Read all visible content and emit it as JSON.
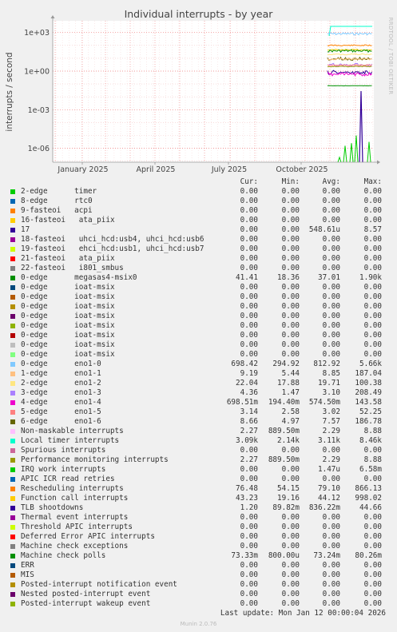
{
  "chart_data": {
    "type": "line",
    "title": "Individual interrupts - by year",
    "ylabel": "interrupts / second",
    "y_scale": "log",
    "yticks": [
      "1e+03",
      "1e+00",
      "1e-03",
      "1e-06"
    ],
    "xticks": [
      "January 2025",
      "April 2025",
      "July 2025",
      "October 2025"
    ],
    "x_range": [
      "2024-12-01",
      "2026-01-12"
    ],
    "grid": true,
    "side_text": "RRDTOOL / TOBI OETIKER",
    "legend_headers": [
      "Cur:",
      "Min:",
      "Avg:",
      "Max:"
    ],
    "legend": [
      {
        "name": "2-edge      timer",
        "color": "#00cc00",
        "cur": "0.00",
        "min": "0.00",
        "avg": "0.00",
        "max": "0.00"
      },
      {
        "name": "8-edge      rtc0",
        "color": "#0066b3",
        "cur": "0.00",
        "min": "0.00",
        "avg": "0.00",
        "max": "0.00"
      },
      {
        "name": "9-fasteoi   acpi",
        "color": "#ff8000",
        "cur": "0.00",
        "min": "0.00",
        "avg": "0.00",
        "max": "0.00"
      },
      {
        "name": "16-fasteoi   ata_piix",
        "color": "#ffcc00",
        "cur": "0.00",
        "min": "0.00",
        "avg": "0.00",
        "max": "0.00"
      },
      {
        "name": "17",
        "color": "#330099",
        "cur": "0.00",
        "min": "0.00",
        "avg": "548.61u",
        "max": "8.57"
      },
      {
        "name": "18-fasteoi   uhci_hcd:usb4, uhci_hcd:usb6",
        "color": "#990099",
        "cur": "0.00",
        "min": "0.00",
        "avg": "0.00",
        "max": "0.00"
      },
      {
        "name": "19-fasteoi   ehci_hcd:usb1, uhci_hcd:usb7",
        "color": "#ccff00",
        "cur": "0.00",
        "min": "0.00",
        "avg": "0.00",
        "max": "0.00"
      },
      {
        "name": "21-fasteoi   ata_piix",
        "color": "#ff0000",
        "cur": "0.00",
        "min": "0.00",
        "avg": "0.00",
        "max": "0.00"
      },
      {
        "name": "22-fasteoi   i801_smbus",
        "color": "#808080",
        "cur": "0.00",
        "min": "0.00",
        "avg": "0.00",
        "max": "0.00"
      },
      {
        "name": "0-edge      megasas4-msix0",
        "color": "#008f00",
        "cur": "41.41",
        "min": "18.36",
        "avg": "37.01",
        "max": "1.90k"
      },
      {
        "name": "0-edge      ioat-msix",
        "color": "#00487d",
        "cur": "0.00",
        "min": "0.00",
        "avg": "0.00",
        "max": "0.00"
      },
      {
        "name": "0-edge      ioat-msix",
        "color": "#b35a00",
        "cur": "0.00",
        "min": "0.00",
        "avg": "0.00",
        "max": "0.00"
      },
      {
        "name": "0-edge      ioat-msix",
        "color": "#b38f00",
        "cur": "0.00",
        "min": "0.00",
        "avg": "0.00",
        "max": "0.00"
      },
      {
        "name": "0-edge      ioat-msix",
        "color": "#6b006b",
        "cur": "0.00",
        "min": "0.00",
        "avg": "0.00",
        "max": "0.00"
      },
      {
        "name": "0-edge      ioat-msix",
        "color": "#8fb300",
        "cur": "0.00",
        "min": "0.00",
        "avg": "0.00",
        "max": "0.00"
      },
      {
        "name": "0-edge      ioat-msix",
        "color": "#b30000",
        "cur": "0.00",
        "min": "0.00",
        "avg": "0.00",
        "max": "0.00"
      },
      {
        "name": "0-edge      ioat-msix",
        "color": "#bebebe",
        "cur": "0.00",
        "min": "0.00",
        "avg": "0.00",
        "max": "0.00"
      },
      {
        "name": "0-edge      ioat-msix",
        "color": "#80ff80",
        "cur": "0.00",
        "min": "0.00",
        "avg": "0.00",
        "max": "0.00"
      },
      {
        "name": "0-edge      eno1-0",
        "color": "#80c9ff",
        "cur": "698.42",
        "min": "294.92",
        "avg": "812.92",
        "max": "5.66k"
      },
      {
        "name": "1-edge      eno1-1",
        "color": "#ffc080",
        "cur": "9.19",
        "min": "5.44",
        "avg": "8.85",
        "max": "187.04"
      },
      {
        "name": "2-edge      eno1-2",
        "color": "#ffe680",
        "cur": "22.04",
        "min": "17.88",
        "avg": "19.71",
        "max": "100.38"
      },
      {
        "name": "3-edge      eno1-3",
        "color": "#aa80ff",
        "cur": "4.36",
        "min": "1.47",
        "avg": "3.10",
        "max": "208.49"
      },
      {
        "name": "4-edge      eno1-4",
        "color": "#ee00cc",
        "cur": "698.51m",
        "min": "194.40m",
        "avg": "574.50m",
        "max": "143.58"
      },
      {
        "name": "5-edge      eno1-5",
        "color": "#ff8080",
        "cur": "3.14",
        "min": "2.58",
        "avg": "3.02",
        "max": "52.25"
      },
      {
        "name": "6-edge      eno1-6",
        "color": "#666600",
        "cur": "8.66",
        "min": "4.97",
        "avg": "7.57",
        "max": "186.78"
      },
      {
        "name": "Non-maskable interrupts",
        "color": "#ffbfff",
        "cur": "2.27",
        "min": "889.50m",
        "avg": "2.29",
        "max": "8.88"
      },
      {
        "name": "Local timer interrupts",
        "color": "#00ffcc",
        "cur": "3.09k",
        "min": "2.14k",
        "avg": "3.11k",
        "max": "8.46k"
      },
      {
        "name": "Spurious interrupts",
        "color": "#cc6699",
        "cur": "0.00",
        "min": "0.00",
        "avg": "0.00",
        "max": "0.00"
      },
      {
        "name": "Performance monitoring interrupts",
        "color": "#999900",
        "cur": "2.27",
        "min": "889.50m",
        "avg": "2.29",
        "max": "8.88"
      },
      {
        "name": "IRQ work interrupts",
        "color": "#00cc00",
        "cur": "0.00",
        "min": "0.00",
        "avg": "1.47u",
        "max": "6.58m"
      },
      {
        "name": "APIC ICR read retries",
        "color": "#0066b3",
        "cur": "0.00",
        "min": "0.00",
        "avg": "0.00",
        "max": "0.00"
      },
      {
        "name": "Rescheduling interrupts",
        "color": "#ff8000",
        "cur": "76.48",
        "min": "54.15",
        "avg": "79.10",
        "max": "866.13"
      },
      {
        "name": "Function call interrupts",
        "color": "#ffcc00",
        "cur": "43.23",
        "min": "19.16",
        "avg": "44.12",
        "max": "998.02"
      },
      {
        "name": "TLB shootdowns",
        "color": "#330099",
        "cur": "1.20",
        "min": "89.82m",
        "avg": "836.22m",
        "max": "44.66"
      },
      {
        "name": "Thermal event interrupts",
        "color": "#990099",
        "cur": "0.00",
        "min": "0.00",
        "avg": "0.00",
        "max": "0.00"
      },
      {
        "name": "Threshold APIC interrupts",
        "color": "#ccff00",
        "cur": "0.00",
        "min": "0.00",
        "avg": "0.00",
        "max": "0.00"
      },
      {
        "name": "Deferred Error APIC interrupts",
        "color": "#ff0000",
        "cur": "0.00",
        "min": "0.00",
        "avg": "0.00",
        "max": "0.00"
      },
      {
        "name": "Machine check exceptions",
        "color": "#808080",
        "cur": "0.00",
        "min": "0.00",
        "avg": "0.00",
        "max": "0.00"
      },
      {
        "name": "Machine check polls",
        "color": "#008f00",
        "cur": "73.33m",
        "min": "800.00u",
        "avg": "73.24m",
        "max": "80.26m"
      },
      {
        "name": "ERR",
        "color": "#00487d",
        "cur": "0.00",
        "min": "0.00",
        "avg": "0.00",
        "max": "0.00"
      },
      {
        "name": "MIS",
        "color": "#b35a00",
        "cur": "0.00",
        "min": "0.00",
        "avg": "0.00",
        "max": "0.00"
      },
      {
        "name": "Posted-interrupt notification event",
        "color": "#b38f00",
        "cur": "0.00",
        "min": "0.00",
        "avg": "0.00",
        "max": "0.00"
      },
      {
        "name": "Nested posted-interrupt event",
        "color": "#6b006b",
        "cur": "0.00",
        "min": "0.00",
        "avg": "0.00",
        "max": "0.00"
      },
      {
        "name": "Posted-interrupt wakeup event",
        "color": "#8fb300",
        "cur": "0.00",
        "min": "0.00",
        "avg": "0.00",
        "max": "0.00"
      }
    ],
    "last_update": "Last update:  Mon Jan 12 00:00:04 2026",
    "footer": "Munin 2.0.76"
  }
}
